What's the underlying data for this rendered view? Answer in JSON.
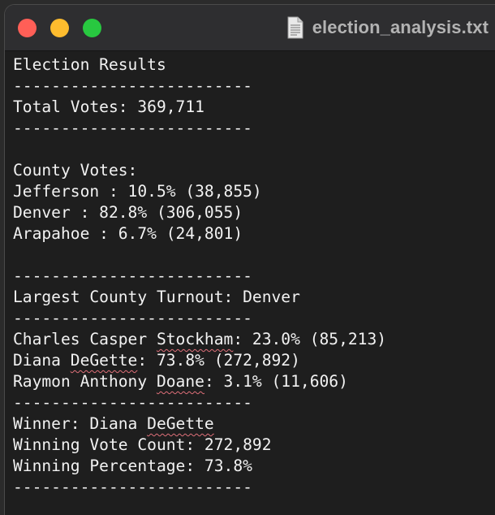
{
  "window": {
    "title": "election_analysis.txt",
    "colors": {
      "close": "#ff5f57",
      "minimize": "#febc2e",
      "maximize": "#28c840"
    }
  },
  "document": {
    "heading": "Election Results",
    "divider": "-------------------------",
    "total_votes_line": "Total Votes: 369,711",
    "county_header": "County Votes:",
    "counties": [
      "Jefferson : 10.5% (38,855)",
      "Denver : 82.8% (306,055)",
      "Arapahoe : 6.7% (24,801)"
    ],
    "largest_county_line": "Largest County Turnout: Denver",
    "candidates": [
      {
        "pre": "Charles Casper ",
        "flagged": "Stockham",
        "post": ": 23.0% (85,213)"
      },
      {
        "pre": "Diana ",
        "flagged": "DeGette",
        "post": ": 73.8% (272,892)"
      },
      {
        "pre": "Raymon Anthony ",
        "flagged": "Doane",
        "post": ": 3.1% (11,606)"
      }
    ],
    "winner": {
      "pre": "Winner: Diana ",
      "flagged": "DeGette",
      "post": ""
    },
    "winning_vote_count_line": "Winning Vote Count: 272,892",
    "winning_percentage_line": "Winning Percentage: 73.8%"
  }
}
